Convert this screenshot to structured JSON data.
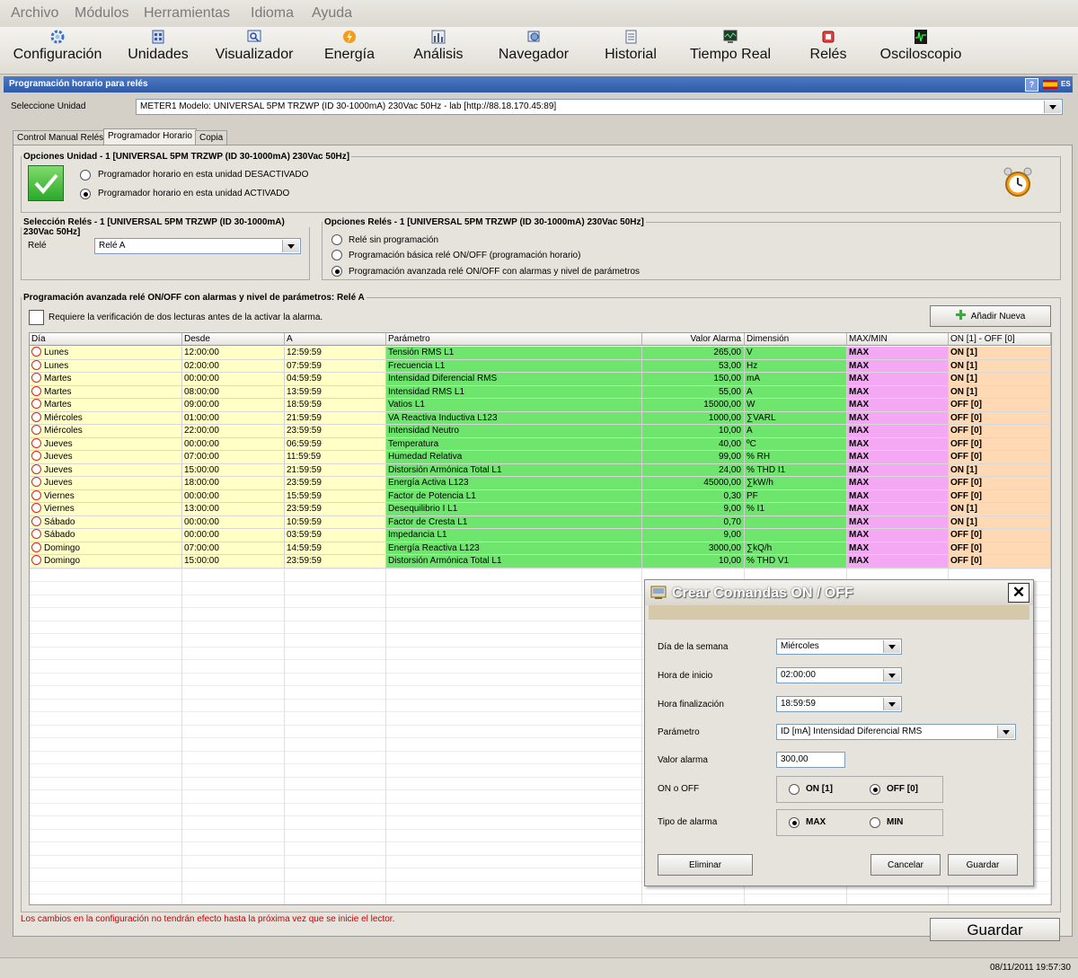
{
  "menu": [
    "Archivo",
    "Módulos",
    "Herramientas",
    "Idioma",
    "Ayuda"
  ],
  "toolbar": [
    {
      "label": "Configuración",
      "icon": "gear-icon"
    },
    {
      "label": "Unidades",
      "icon": "units-icon"
    },
    {
      "label": "Visualizador",
      "icon": "viewer-icon"
    },
    {
      "label": "Energía",
      "icon": "energy-icon"
    },
    {
      "label": "Análisis",
      "icon": "analysis-icon"
    },
    {
      "label": "Navegador",
      "icon": "navigator-icon"
    },
    {
      "label": "Historial",
      "icon": "history-icon"
    },
    {
      "label": "Tiempo Real",
      "icon": "realtime-icon"
    },
    {
      "label": "Relés",
      "icon": "relay-icon"
    },
    {
      "label": "Osciloscopio",
      "icon": "oscilloscope-icon"
    }
  ],
  "window": {
    "title": "Programación horario para relés",
    "help": "?",
    "language": "ES"
  },
  "unit": {
    "label": "Seleccione Unidad",
    "value": "METER1  Modelo: UNIVERSAL 5PM TRZWP (ID 30-1000mA) 230Vac 50Hz - lab [http://88.18.170.45:89]"
  },
  "tabs": [
    "Control Manual Relés",
    "Programador Horario",
    "Copia"
  ],
  "options_unit": {
    "legend": "Opciones Unidad - 1 [UNIVERSAL 5PM TRZWP (ID 30-1000mA) 230Vac 50Hz]",
    "off": "Programador horario en esta unidad DESACTIVADO",
    "on": "Programador horario en esta unidad ACTIVADO"
  },
  "relay_select": {
    "legend": "Selección Relés - 1 [UNIVERSAL 5PM TRZWP (ID 30-1000mA) 230Vac 50Hz]",
    "label": "Relé",
    "value": "Relé A"
  },
  "relay_options": {
    "legend": "Opciones Relés - 1 [UNIVERSAL 5PM TRZWP (ID 30-1000mA) 230Vac 50Hz]",
    "opt1": "Relé sin programación",
    "opt2": "Programación básica relé ON/OFF (programación horario)",
    "opt3": "Programación avanzada relé ON/OFF con alarmas y nivel de parámetros"
  },
  "advanced": {
    "legend": "Programación avanzada relé ON/OFF con alarmas y nivel de parámetros:  Relé A",
    "checkbox": "Requiere la verificación de dos lecturas antes de la activar la alarma.",
    "add_button": "Añadir Nueva"
  },
  "table": {
    "headers": [
      "Día",
      "Desde",
      "A",
      "Parámetro",
      "Valor Alarma",
      "Dimensión",
      "MAX/MIN",
      "ON [1] - OFF [0]"
    ],
    "rows": [
      [
        "Lunes",
        "12:00:00",
        "12:59:59",
        "Tensión RMS L1",
        "265,00",
        "V",
        "MAX",
        "ON [1]"
      ],
      [
        "Lunes",
        "02:00:00",
        "07:59:59",
        "Frecuencia L1",
        "53,00",
        "Hz",
        "MAX",
        "ON [1]"
      ],
      [
        "Martes",
        "00:00:00",
        "04:59:59",
        "Intensidad Diferencial RMS",
        "150,00",
        "mA",
        "MAX",
        "ON [1]"
      ],
      [
        "Martes",
        "08:00:00",
        "13:59:59",
        "Intensidad RMS L1",
        "55,00",
        "A",
        "MAX",
        "ON [1]"
      ],
      [
        "Martes",
        "09:00:00",
        "18:59:59",
        "Vatios L1",
        "15000,00",
        "W",
        "MAX",
        "OFF [0]"
      ],
      [
        "Miércoles",
        "01:00:00",
        "21:59:59",
        "VA Reactiva Inductiva L123",
        "1000,00",
        "∑VARL",
        "MAX",
        "OFF [0]"
      ],
      [
        "Miércoles",
        "22:00:00",
        "23:59:59",
        "Intensidad Neutro",
        "10,00",
        "A",
        "MAX",
        "OFF [0]"
      ],
      [
        "Jueves",
        "00:00:00",
        "06:59:59",
        "Temperatura",
        "40,00",
        "ºC",
        "MAX",
        "OFF [0]"
      ],
      [
        "Jueves",
        "07:00:00",
        "11:59:59",
        "Humedad Relativa",
        "99,00",
        "% RH",
        "MAX",
        "OFF [0]"
      ],
      [
        "Jueves",
        "15:00:00",
        "21:59:59",
        "Distorsión Armónica Total L1",
        "24,00",
        "% THD I1",
        "MAX",
        "ON [1]"
      ],
      [
        "Jueves",
        "18:00:00",
        "23:59:59",
        "Energía Activa L123",
        "45000,00",
        "∑kW/h",
        "MAX",
        "OFF [0]"
      ],
      [
        "Viernes",
        "00:00:00",
        "15:59:59",
        "Factor de Potencia L1",
        "0,30",
        "PF",
        "MAX",
        "OFF [0]"
      ],
      [
        "Viernes",
        "13:00:00",
        "23:59:59",
        "Desequilibrio I L1",
        "9,00",
        "% I1",
        "MAX",
        "ON [1]"
      ],
      [
        "Sábado",
        "00:00:00",
        "10:59:59",
        "Factor de Cresta L1",
        "0,70",
        "",
        "MAX",
        "ON [1]"
      ],
      [
        "Sábado",
        "00:00:00",
        "03:59:59",
        "Impedancia L1",
        "9,00",
        "",
        "MAX",
        "OFF [0]"
      ],
      [
        "Domingo",
        "07:00:00",
        "14:59:59",
        "Energía Reactiva L123",
        "3000,00",
        "∑kQ/h",
        "MAX",
        "OFF [0]"
      ],
      [
        "Domingo",
        "15:00:00",
        "23:59:59",
        "Distorsión Armónica Total L1",
        "10,00",
        "% THD V1",
        "MAX",
        "OFF [0]"
      ]
    ]
  },
  "dialog": {
    "title": "Crear Comandas ON / OFF",
    "day_label": "Día de la semana",
    "day_value": "Miércoles",
    "start_label": "Hora de inicio",
    "start_value": "02:00:00",
    "end_label": "Hora finalización",
    "end_value": "18:59:59",
    "param_label": "Parámetro",
    "param_value": "ID [mA] Intensidad Diferencial RMS",
    "alarm_label": "Valor alarma",
    "alarm_value": "300,00",
    "onoff_label": "ON o OFF",
    "on": "ON [1]",
    "off": "OFF [0]",
    "type_label": "Tipo de alarma",
    "max": "MAX",
    "min": "MIN",
    "delete": "Eliminar",
    "cancel": "Cancelar",
    "save": "Guardar"
  },
  "footer": {
    "warning": "Los cambios en la configuración no tendrán efecto hasta la próxima vez que se inicie el lector.",
    "save": "Guardar",
    "date": "08/11/2011",
    "time": "19:57:30"
  },
  "colors": {
    "day_col": "#ffffc6",
    "param_col": "#6ee66e",
    "maxmin_col": "#f4a8f4",
    "onoff_col": "#ffd8b4",
    "title_bar": "#3a64b4",
    "warning": "#cc0000"
  }
}
